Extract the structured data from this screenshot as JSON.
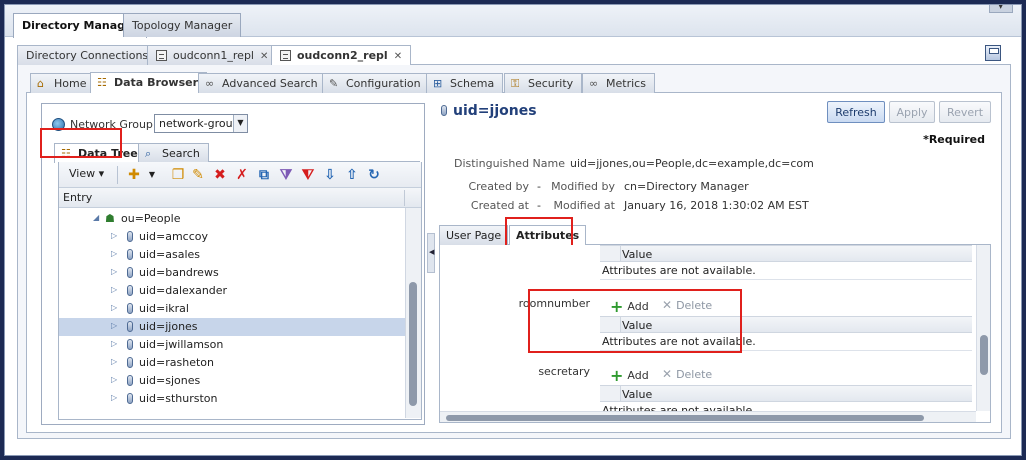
{
  "app_tabs": [
    "Directory Manager",
    "Topology Manager"
  ],
  "connection_tabs": [
    {
      "label": "Directory Connections"
    },
    {
      "label": "oudconn1_repl"
    },
    {
      "label": "oudconn2_repl"
    }
  ],
  "nav_tabs": [
    "Home",
    "Data Browser",
    "Advanced Search",
    "Configuration",
    "Schema",
    "Security",
    "Metrics"
  ],
  "left": {
    "network_group_label": "Network Group",
    "network_group_value": "network-group",
    "subtabs": [
      "Data Tree",
      "Search"
    ],
    "view_label": "View",
    "entry_header": "Entry",
    "tree": {
      "parent": "ou=People",
      "items": [
        "uid=amccoy",
        "uid=asales",
        "uid=bandrews",
        "uid=dalexander",
        "uid=ikral",
        "uid=jjones",
        "uid=jwillamson",
        "uid=rasheton",
        "uid=sjones",
        "uid=sthurston"
      ],
      "selected": "uid=jjones"
    }
  },
  "right": {
    "title": "uid=jjones",
    "buttons": {
      "refresh": "Refresh",
      "apply": "Apply",
      "revert": "Revert"
    },
    "required": "*Required",
    "meta": {
      "dn_label": "Distinguished Name",
      "dn_value": "uid=jjones,ou=People,dc=example,dc=com",
      "created_by_label": "Created by",
      "created_by_value": "-",
      "modified_by_label": "Modified by",
      "modified_by_value": "cn=Directory Manager",
      "created_at_label": "Created at",
      "created_at_value": "-",
      "modified_at_label": "Modified at",
      "modified_at_value": "January 16, 2018 1:30:02 AM EST"
    },
    "attr_tabs": [
      "User Page",
      "Attributes"
    ],
    "value_header": "Value",
    "empty_text": "Attributes are not available.",
    "add_label": "Add",
    "delete_label": "Delete",
    "attributes": [
      "roomnumber",
      "secretary"
    ]
  },
  "colors": {
    "highlight": "#e0201c",
    "selection": "#c7d5ea",
    "title": "#22407a"
  }
}
